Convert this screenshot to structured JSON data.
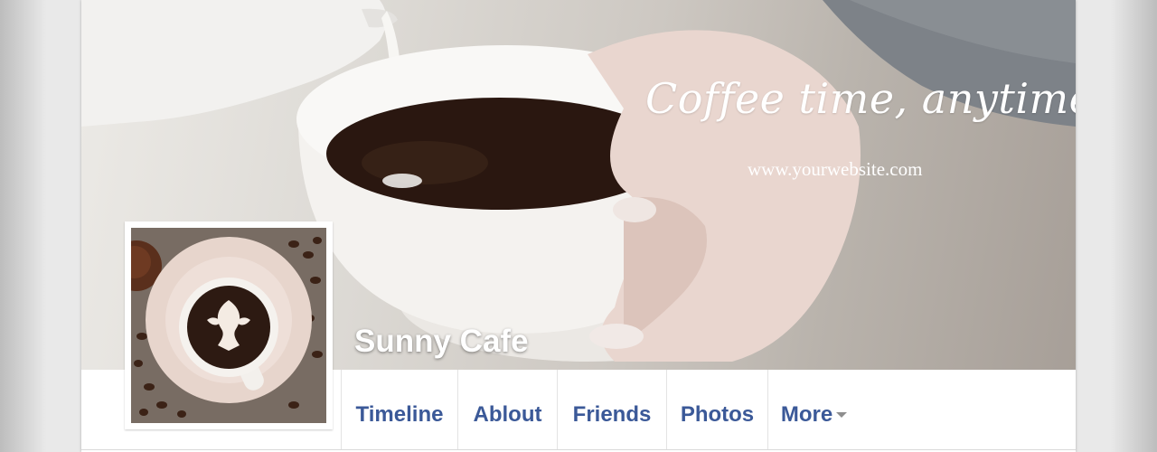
{
  "cover": {
    "tagline": "Coffee time, anytime",
    "website": "www.yourwebsite.com"
  },
  "page": {
    "name": "Sunny Cafe"
  },
  "nav": {
    "tabs": [
      {
        "label": "Timeline"
      },
      {
        "label": "Ablout"
      },
      {
        "label": "Friends"
      },
      {
        "label": "Photos"
      },
      {
        "label": "More"
      }
    ],
    "more_icon": "caret-down-icon"
  },
  "colors": {
    "link": "#3b5998",
    "text_on_cover": "#ffffff",
    "coffee": "#2a1710",
    "cup": "#f4f2ef"
  }
}
